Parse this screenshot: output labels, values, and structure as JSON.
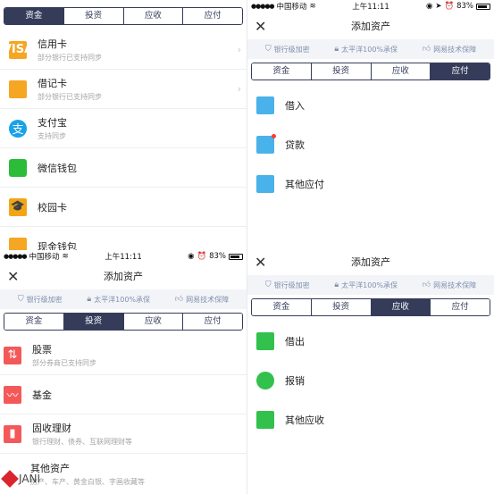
{
  "common": {
    "carrier": "中国移动",
    "time": "上午11:11",
    "battery": "83%",
    "title": "添加资产",
    "close_glyph": "✕",
    "badges": [
      "银行级加密",
      "太平洋100%承保",
      "网易技术保障"
    ],
    "tabs": [
      "资金",
      "投资",
      "应收",
      "应付"
    ]
  },
  "panel_funds": {
    "active_tab": "资金",
    "items": [
      {
        "name": "信用卡",
        "sub": "部分银行已支持同步",
        "icon": "visa-card-icon",
        "icon_text": "VISA",
        "chevron": "›"
      },
      {
        "name": "借记卡",
        "sub": "部分银行已支持同步",
        "icon": "debit-card-icon",
        "icon_text": "",
        "chevron": "›"
      },
      {
        "name": "支付宝",
        "sub": "支持同步",
        "icon": "alipay-icon",
        "icon_text": "支"
      },
      {
        "name": "微信钱包",
        "sub": "",
        "icon": "wechat-wallet-icon",
        "icon_text": ""
      },
      {
        "name": "校园卡",
        "sub": "",
        "icon": "campus-card-icon",
        "icon_text": "🎓"
      },
      {
        "name": "现金钱包",
        "sub": "",
        "icon": "cash-wallet-icon",
        "icon_text": ""
      }
    ]
  },
  "panel_payable": {
    "active_tab": "应付",
    "items": [
      {
        "name": "借入",
        "icon": "borrow-in-icon"
      },
      {
        "name": "贷款",
        "icon": "loan-icon"
      },
      {
        "name": "其他应付",
        "icon": "other-payable-icon"
      }
    ]
  },
  "panel_invest": {
    "active_tab": "投资",
    "items": [
      {
        "name": "股票",
        "sub": "部分券商已支持同步",
        "icon": "stock-icon",
        "icon_text": "⇅"
      },
      {
        "name": "基金",
        "sub": "",
        "icon": "fund-icon",
        "icon_text": "〰"
      },
      {
        "name": "固收理财",
        "sub": "银行理财、债券、互联网理财等",
        "icon": "fixed-income-icon",
        "icon_text": "▮"
      },
      {
        "name": "其他资产",
        "sub": "房产、车产、黄金白银、字画收藏等",
        "icon": "other-asset-icon",
        "icon_text": ""
      }
    ],
    "watermark": "JANI"
  },
  "panel_receivable": {
    "active_tab": "应收",
    "items": [
      {
        "name": "借出",
        "icon": "lend-out-icon"
      },
      {
        "name": "报销",
        "icon": "reimburse-icon"
      },
      {
        "name": "其他应收",
        "icon": "other-receivable-icon"
      }
    ]
  },
  "colors": {
    "accent": "#343c5a",
    "badge_text": "#7f90ad",
    "orange": "#f5a623",
    "blue": "#1aa1e8",
    "green": "#2dbb3a",
    "red": "#f45959"
  }
}
